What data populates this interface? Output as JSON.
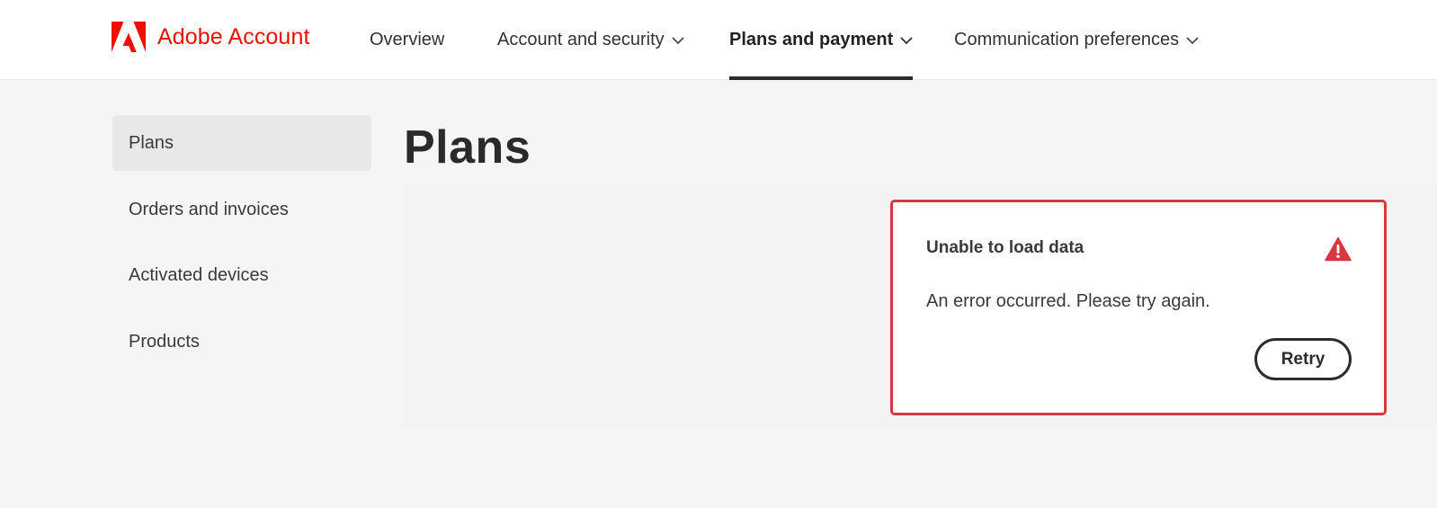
{
  "brand": {
    "name": "Adobe Account",
    "color": "#eb1000",
    "logo_icon": "adobe-logo-icon"
  },
  "nav": {
    "items": [
      {
        "label": "Overview",
        "has_dropdown": false,
        "active": false
      },
      {
        "label": "Account and security",
        "has_dropdown": true,
        "active": false
      },
      {
        "label": "Plans and payment",
        "has_dropdown": true,
        "active": true
      },
      {
        "label": "Communication preferences",
        "has_dropdown": true,
        "active": false
      }
    ]
  },
  "sidebar": {
    "items": [
      {
        "label": "Plans",
        "selected": true
      },
      {
        "label": "Orders and invoices",
        "selected": false
      },
      {
        "label": "Activated devices",
        "selected": false
      },
      {
        "label": "Products",
        "selected": false
      }
    ]
  },
  "main": {
    "title": "Plans"
  },
  "error": {
    "title": "Unable to load data",
    "message": "An error occurred. Please try again.",
    "retry_label": "Retry",
    "icon": "alert-triangle-icon",
    "border_color": "#d7373f"
  }
}
